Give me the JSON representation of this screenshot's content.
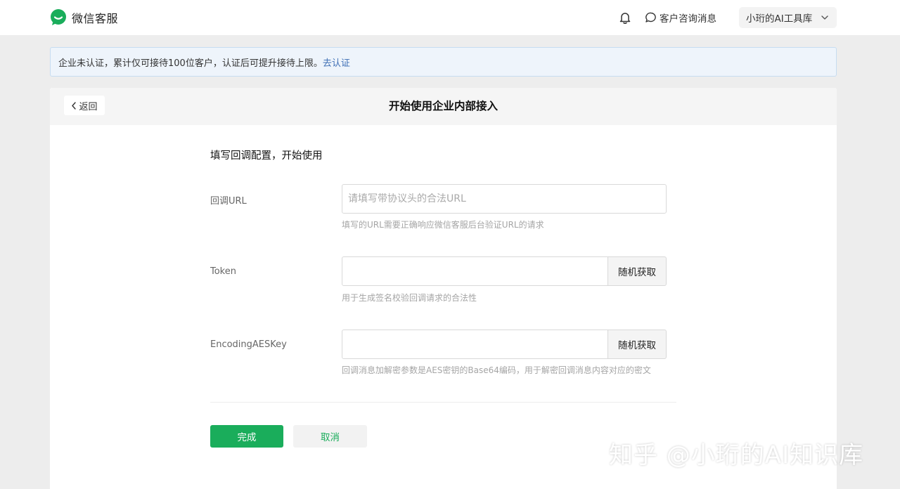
{
  "header": {
    "brand_name": "微信客服",
    "consult_label": "客户咨询消息",
    "account_name": "小珩的AI工具库"
  },
  "notice": {
    "text": "企业未认证，累计仅可接待100位客户，认证后可提升接待上限。",
    "link": "去认证"
  },
  "page": {
    "back_label": "返回",
    "title": "开始使用企业内部接入",
    "section_title": "填写回调配置，开始使用"
  },
  "form": {
    "url": {
      "label": "回调URL",
      "placeholder": "请填写带协议头的合法URL",
      "value": "",
      "hint": "填写的URL需要正确响应微信客服后台验证URL的请求"
    },
    "token": {
      "label": "Token",
      "value": "",
      "button": "随机获取",
      "hint": "用于生成签名校验回调请求的合法性"
    },
    "aes": {
      "label": "EncodingAESKey",
      "value": "",
      "button": "随机获取",
      "hint": "回调消息加解密参数是AES密钥的Base64编码，用于解密回调消息内容对应的密文"
    }
  },
  "actions": {
    "done": "完成",
    "cancel": "取消"
  },
  "watermark": "知乎 @小珩的AI知识库",
  "icons": [
    "wechat-logo-icon",
    "bell-icon",
    "chat-bubble-icon",
    "chevron-down-icon",
    "chevron-left-icon"
  ],
  "colors": {
    "primary_green": "#1aad5b",
    "notice_bg": "#eef4fb",
    "link_blue": "#3f6fb5"
  }
}
